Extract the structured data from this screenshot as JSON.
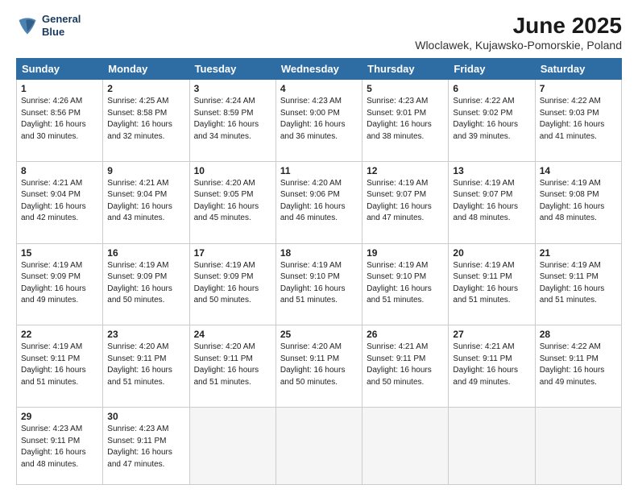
{
  "logo": {
    "line1": "General",
    "line2": "Blue"
  },
  "title": "June 2025",
  "subtitle": "Wloclawek, Kujawsko-Pomorskie, Poland",
  "headers": [
    "Sunday",
    "Monday",
    "Tuesday",
    "Wednesday",
    "Thursday",
    "Friday",
    "Saturday"
  ],
  "weeks": [
    [
      {
        "day": "1",
        "lines": [
          "Sunrise: 4:26 AM",
          "Sunset: 8:56 PM",
          "Daylight: 16 hours",
          "and 30 minutes."
        ]
      },
      {
        "day": "2",
        "lines": [
          "Sunrise: 4:25 AM",
          "Sunset: 8:58 PM",
          "Daylight: 16 hours",
          "and 32 minutes."
        ]
      },
      {
        "day": "3",
        "lines": [
          "Sunrise: 4:24 AM",
          "Sunset: 8:59 PM",
          "Daylight: 16 hours",
          "and 34 minutes."
        ]
      },
      {
        "day": "4",
        "lines": [
          "Sunrise: 4:23 AM",
          "Sunset: 9:00 PM",
          "Daylight: 16 hours",
          "and 36 minutes."
        ]
      },
      {
        "day": "5",
        "lines": [
          "Sunrise: 4:23 AM",
          "Sunset: 9:01 PM",
          "Daylight: 16 hours",
          "and 38 minutes."
        ]
      },
      {
        "day": "6",
        "lines": [
          "Sunrise: 4:22 AM",
          "Sunset: 9:02 PM",
          "Daylight: 16 hours",
          "and 39 minutes."
        ]
      },
      {
        "day": "7",
        "lines": [
          "Sunrise: 4:22 AM",
          "Sunset: 9:03 PM",
          "Daylight: 16 hours",
          "and 41 minutes."
        ]
      }
    ],
    [
      {
        "day": "8",
        "lines": [
          "Sunrise: 4:21 AM",
          "Sunset: 9:04 PM",
          "Daylight: 16 hours",
          "and 42 minutes."
        ]
      },
      {
        "day": "9",
        "lines": [
          "Sunrise: 4:21 AM",
          "Sunset: 9:04 PM",
          "Daylight: 16 hours",
          "and 43 minutes."
        ]
      },
      {
        "day": "10",
        "lines": [
          "Sunrise: 4:20 AM",
          "Sunset: 9:05 PM",
          "Daylight: 16 hours",
          "and 45 minutes."
        ]
      },
      {
        "day": "11",
        "lines": [
          "Sunrise: 4:20 AM",
          "Sunset: 9:06 PM",
          "Daylight: 16 hours",
          "and 46 minutes."
        ]
      },
      {
        "day": "12",
        "lines": [
          "Sunrise: 4:19 AM",
          "Sunset: 9:07 PM",
          "Daylight: 16 hours",
          "and 47 minutes."
        ]
      },
      {
        "day": "13",
        "lines": [
          "Sunrise: 4:19 AM",
          "Sunset: 9:07 PM",
          "Daylight: 16 hours",
          "and 48 minutes."
        ]
      },
      {
        "day": "14",
        "lines": [
          "Sunrise: 4:19 AM",
          "Sunset: 9:08 PM",
          "Daylight: 16 hours",
          "and 48 minutes."
        ]
      }
    ],
    [
      {
        "day": "15",
        "lines": [
          "Sunrise: 4:19 AM",
          "Sunset: 9:09 PM",
          "Daylight: 16 hours",
          "and 49 minutes."
        ]
      },
      {
        "day": "16",
        "lines": [
          "Sunrise: 4:19 AM",
          "Sunset: 9:09 PM",
          "Daylight: 16 hours",
          "and 50 minutes."
        ]
      },
      {
        "day": "17",
        "lines": [
          "Sunrise: 4:19 AM",
          "Sunset: 9:09 PM",
          "Daylight: 16 hours",
          "and 50 minutes."
        ]
      },
      {
        "day": "18",
        "lines": [
          "Sunrise: 4:19 AM",
          "Sunset: 9:10 PM",
          "Daylight: 16 hours",
          "and 51 minutes."
        ]
      },
      {
        "day": "19",
        "lines": [
          "Sunrise: 4:19 AM",
          "Sunset: 9:10 PM",
          "Daylight: 16 hours",
          "and 51 minutes."
        ]
      },
      {
        "day": "20",
        "lines": [
          "Sunrise: 4:19 AM",
          "Sunset: 9:11 PM",
          "Daylight: 16 hours",
          "and 51 minutes."
        ]
      },
      {
        "day": "21",
        "lines": [
          "Sunrise: 4:19 AM",
          "Sunset: 9:11 PM",
          "Daylight: 16 hours",
          "and 51 minutes."
        ]
      }
    ],
    [
      {
        "day": "22",
        "lines": [
          "Sunrise: 4:19 AM",
          "Sunset: 9:11 PM",
          "Daylight: 16 hours",
          "and 51 minutes."
        ]
      },
      {
        "day": "23",
        "lines": [
          "Sunrise: 4:20 AM",
          "Sunset: 9:11 PM",
          "Daylight: 16 hours",
          "and 51 minutes."
        ]
      },
      {
        "day": "24",
        "lines": [
          "Sunrise: 4:20 AM",
          "Sunset: 9:11 PM",
          "Daylight: 16 hours",
          "and 51 minutes."
        ]
      },
      {
        "day": "25",
        "lines": [
          "Sunrise: 4:20 AM",
          "Sunset: 9:11 PM",
          "Daylight: 16 hours",
          "and 50 minutes."
        ]
      },
      {
        "day": "26",
        "lines": [
          "Sunrise: 4:21 AM",
          "Sunset: 9:11 PM",
          "Daylight: 16 hours",
          "and 50 minutes."
        ]
      },
      {
        "day": "27",
        "lines": [
          "Sunrise: 4:21 AM",
          "Sunset: 9:11 PM",
          "Daylight: 16 hours",
          "and 49 minutes."
        ]
      },
      {
        "day": "28",
        "lines": [
          "Sunrise: 4:22 AM",
          "Sunset: 9:11 PM",
          "Daylight: 16 hours",
          "and 49 minutes."
        ]
      }
    ],
    [
      {
        "day": "29",
        "lines": [
          "Sunrise: 4:23 AM",
          "Sunset: 9:11 PM",
          "Daylight: 16 hours",
          "and 48 minutes."
        ]
      },
      {
        "day": "30",
        "lines": [
          "Sunrise: 4:23 AM",
          "Sunset: 9:11 PM",
          "Daylight: 16 hours",
          "and 47 minutes."
        ]
      },
      null,
      null,
      null,
      null,
      null
    ]
  ]
}
